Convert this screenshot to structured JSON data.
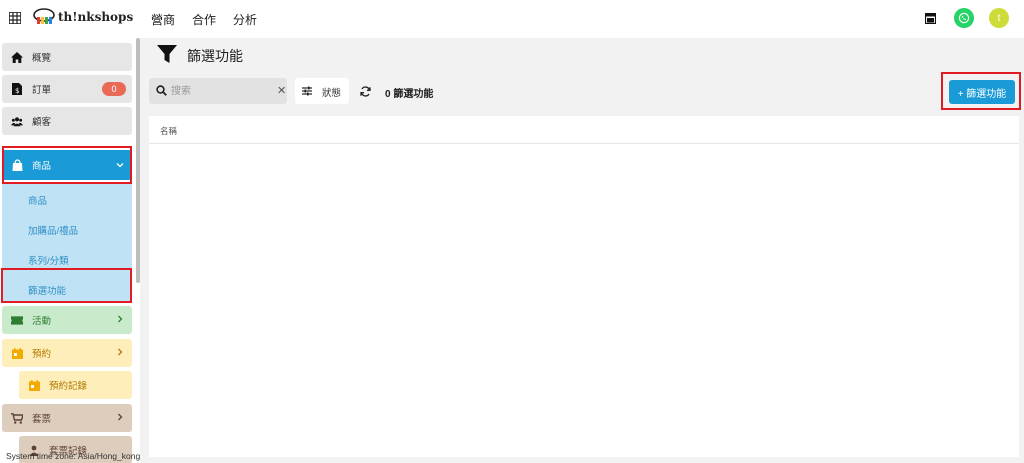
{
  "topbar": {
    "logo_text": "th!nkshops",
    "nav": [
      {
        "label": "營商",
        "active": true
      },
      {
        "label": "合作",
        "active": false
      },
      {
        "label": "分析",
        "active": false
      }
    ],
    "avatar_letter": "t",
    "icons": [
      "grid-icon",
      "store-icon",
      "whatsapp-icon"
    ]
  },
  "sidebar": {
    "overview": "概覽",
    "orders": {
      "label": "訂單",
      "badge": "0"
    },
    "customers": "顧客",
    "products": {
      "label": "商品",
      "expanded": true,
      "sub": [
        "商品",
        "加購品/禮品",
        "系列/分類",
        "篩選功能"
      ]
    },
    "events": "活動",
    "booking": {
      "label": "預約",
      "sub": "預約記錄"
    },
    "tickets": {
      "label": "套票",
      "sub": "套票記錄"
    },
    "timezone": "System time zone: Asia/Hong_kong"
  },
  "page": {
    "title": "篩選功能",
    "search_placeholder": "搜索",
    "status_label": "狀態",
    "count_text": "0 篩選功能",
    "add_button": "+ 篩選功能",
    "column_name": "名稱"
  },
  "colors": {
    "accent": "#1a9ad6",
    "badge": "#ea6a58",
    "highlight": "#e01b24",
    "events": "#c9ebcc",
    "booking": "#fdeeba",
    "tickets": "#dccdbd"
  }
}
